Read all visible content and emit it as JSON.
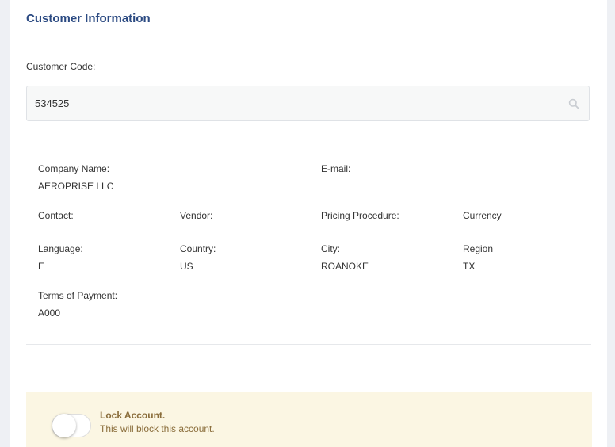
{
  "section_title": "Customer Information",
  "customer_code": {
    "label": "Customer Code:",
    "value": "534525"
  },
  "info": {
    "company_name": {
      "label": "Company Name:",
      "value": "AEROPRISE LLC"
    },
    "email": {
      "label": "E-mail:",
      "value": ""
    },
    "contact": {
      "label": "Contact:",
      "value": ""
    },
    "vendor": {
      "label": "Vendor:",
      "value": ""
    },
    "pricing_procedure": {
      "label": "Pricing Procedure:",
      "value": ""
    },
    "currency": {
      "label": "Currency",
      "value": ""
    },
    "language": {
      "label": "Language:",
      "value": "E"
    },
    "country": {
      "label": "Country:",
      "value": "US"
    },
    "city": {
      "label": "City:",
      "value": "ROANOKE"
    },
    "region": {
      "label": "Region",
      "value": "TX"
    },
    "terms_of_payment": {
      "label": "Terms of Payment:",
      "value": "A000"
    }
  },
  "lock_account": {
    "title": "Lock Account.",
    "description": "This will block this account.",
    "enabled": false
  },
  "colors": {
    "title": "#2b4a82",
    "warning_bg": "#fbf6e3",
    "warning_text": "#8a6d3b"
  },
  "icons": {
    "search": "search-icon"
  }
}
